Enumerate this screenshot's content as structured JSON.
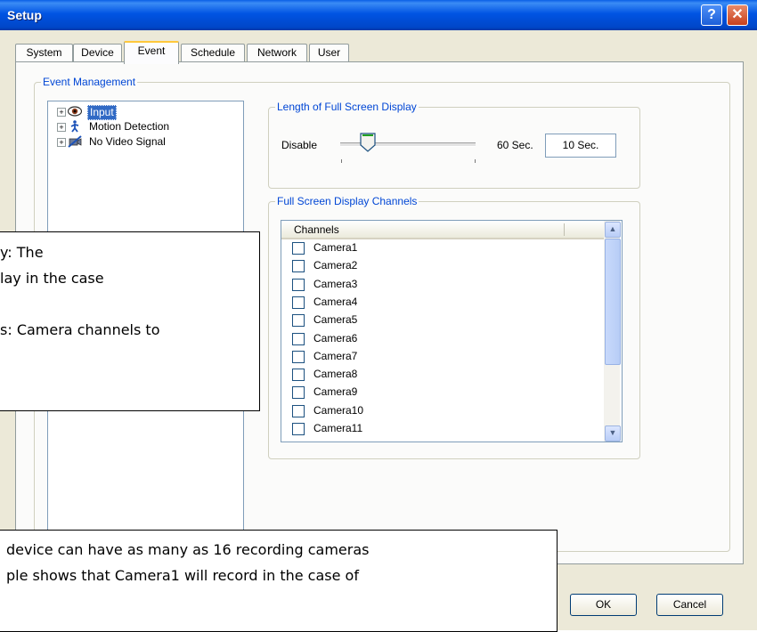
{
  "window": {
    "title": "Setup",
    "help_glyph": "?",
    "close_glyph": "✕"
  },
  "tabs": [
    "System",
    "Device",
    "Event",
    "Schedule",
    "Network",
    "User"
  ],
  "event_management": {
    "label": "Event Management",
    "tree": [
      {
        "label": "Input",
        "icon": "eye-icon",
        "selected": true
      },
      {
        "label": "Motion Detection",
        "icon": "running-person-icon",
        "selected": false
      },
      {
        "label": "No Video Signal",
        "icon": "no-camera-icon",
        "selected": false
      }
    ]
  },
  "full_screen_display": {
    "label": "Length of Full Screen Display",
    "disable_label": "Disable",
    "max_label": "60 Sec.",
    "value": "10 Sec.",
    "slider_fraction": 0.2
  },
  "channels": {
    "label": "Full Screen Display Channels",
    "header": "Channels",
    "items": [
      "Camera1",
      "Camera2",
      "Camera3",
      "Camera4",
      "Camera5",
      "Camera6",
      "Camera7",
      "Camera8",
      "Camera9",
      "Camera10",
      "Camera11"
    ]
  },
  "buttons": {
    "ok": "OK",
    "cancel": "Cancel"
  },
  "callout_top": {
    "line1": "y: The",
    "line2": "lay in the case",
    "line3": "s: Camera channels to"
  },
  "callout_bottom": {
    "line1": "device can have as many as 16 recording cameras",
    "line2": "ple shows that Camera1 will record in the case of"
  },
  "colors": {
    "title_bar": "#0054e3",
    "group_label": "#0046d5",
    "selection": "#316ac5",
    "tab_highlight": "#ffc83c"
  }
}
